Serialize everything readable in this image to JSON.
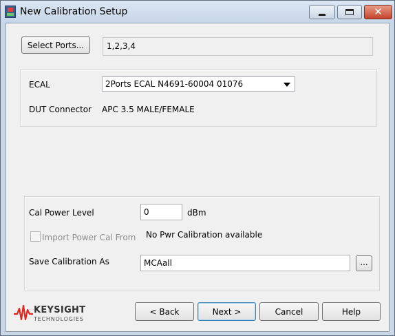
{
  "window": {
    "title": "New Calibration Setup",
    "icons": {
      "app": "keysight-app-icon",
      "minimize": "minimize-icon",
      "maximize": "maximize-icon",
      "close": "close-icon"
    },
    "close_glyph": "✕"
  },
  "ports": {
    "button_label": "Select Ports...",
    "value": "1,2,3,4"
  },
  "ecal": {
    "label": "ECAL",
    "selected": "2Ports ECAL N4691-60004 01076",
    "connector_label": "DUT Connector",
    "connector_value": "APC 3.5 MALE/FEMALE"
  },
  "power": {
    "label": "Cal Power Level",
    "value": "0",
    "unit": "dBm"
  },
  "import_cal": {
    "label": "Import Power Cal From",
    "checked": false,
    "status": "No Pwr Calibration available"
  },
  "save": {
    "label": "Save Calibration As",
    "value": "MCAall",
    "browse_label": "..."
  },
  "logo": {
    "brand": "KEYSIGHT",
    "sub": "TECHNOLOGIES",
    "color": "#e1261c"
  },
  "buttons": {
    "back": "< Back",
    "next": "Next >",
    "cancel": "Cancel",
    "help": "Help"
  }
}
